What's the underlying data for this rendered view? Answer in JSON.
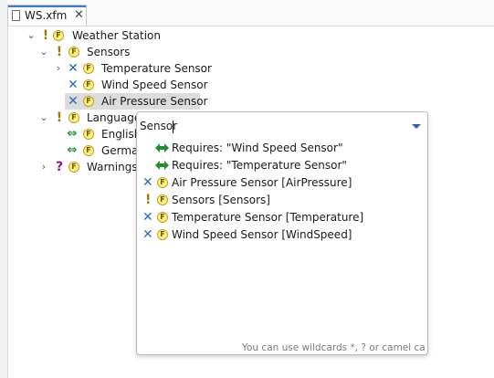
{
  "editor": {
    "tab": {
      "title": "WS.xfm",
      "close_icon": "close-icon"
    }
  },
  "tree": {
    "weather_station": {
      "marker": "!",
      "label": "Weather Station"
    },
    "sensors": {
      "marker": "!",
      "label": "Sensors"
    },
    "temperature_sensor": {
      "marker": "✕",
      "label": "Temperature Sensor"
    },
    "wind_speed_sensor": {
      "marker": "✕",
      "label": "Wind Speed Sensor"
    },
    "air_pressure_sensor": {
      "marker": "✕",
      "label": "Air Pressure Sensor"
    },
    "languages": {
      "marker": "!",
      "label": "Languages"
    },
    "english": {
      "label": "English"
    },
    "german": {
      "label": "German"
    },
    "warnings": {
      "marker": "?",
      "label": "Warnings"
    }
  },
  "feature_icon_letter": "F",
  "popup": {
    "search_value": "Sensor",
    "items": [
      {
        "icon": "requires-arrow-icon",
        "label": "Requires: \"Wind Speed Sensor\""
      },
      {
        "icon": "requires-arrow-icon",
        "label": "Requires: \"Temperature Sensor\""
      },
      {
        "icon": "blue-x-icon",
        "label": "Air Pressure Sensor [AirPressure]"
      },
      {
        "icon": "exclamation-icon",
        "label": "Sensors [Sensors]"
      },
      {
        "icon": "blue-x-icon",
        "label": "Temperature Sensor [Temperature]"
      },
      {
        "icon": "blue-x-icon",
        "label": "Wind Speed Sensor [WindSpeed]"
      }
    ],
    "hint": "You can use wildcards *, ? or camel case"
  },
  "colors": {
    "exclamation": "#a07a00",
    "question": "#8a1a8a",
    "x_mark": "#2a6dbb",
    "requires_arrow": "#1e8f2a",
    "feature_fill": "#fff07a",
    "tab_accent": "#3d7bd0",
    "selection": "#dcdcdc"
  }
}
